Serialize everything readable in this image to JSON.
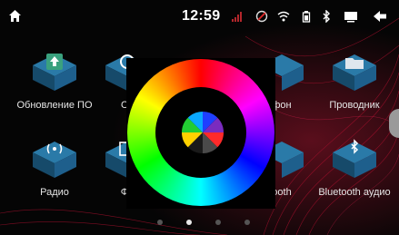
{
  "status_bar": {
    "time": "12:59",
    "icons": [
      "home-icon",
      "signal-icon",
      "gps-icon",
      "wifi-icon",
      "battery-icon",
      "bluetooth-icon",
      "screen-icon",
      "back-icon"
    ]
  },
  "apps": [
    {
      "label": "Обновление ПО",
      "icon": "update-icon"
    },
    {
      "label": "Ос",
      "icon": "settings-icon"
    },
    {
      "label": "фон",
      "icon": "phone-icon"
    },
    {
      "label": "Проводник",
      "icon": "folder-icon"
    },
    {
      "label": "Радио",
      "icon": "radio-icon"
    },
    {
      "label": "Фо",
      "icon": "photo-icon"
    },
    {
      "label": "ooth",
      "icon": "bluetooth-icon"
    },
    {
      "label": "Bluetooth аудио",
      "icon": "bluetooth-audio-icon"
    }
  ],
  "color_picker": {
    "presets": [
      "#1f3fff",
      "#7a2bbf",
      "#ff2a2a",
      "#4a4a4a",
      "#1a1a1a",
      "#ffd100",
      "#22cc33",
      "#0aa8ff"
    ]
  },
  "pager": {
    "pages": 4,
    "active_index": 1
  },
  "colors": {
    "accent_red": "#d0103a",
    "tile_blue": "#1e5f8c",
    "background": "#050505"
  }
}
